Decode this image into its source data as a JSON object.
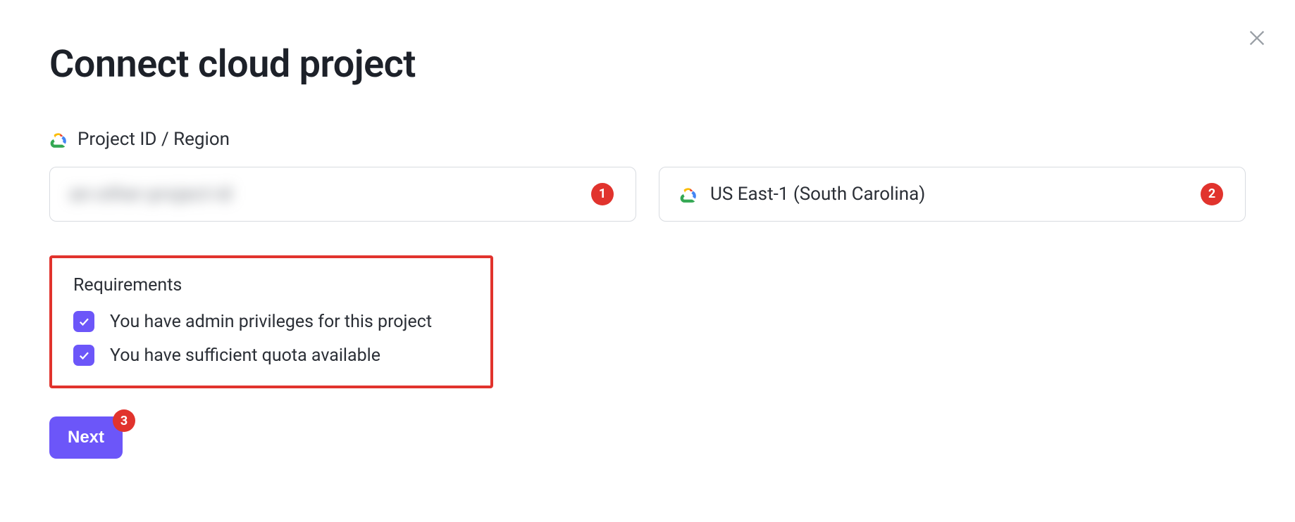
{
  "header": {
    "title": "Connect cloud project"
  },
  "section": {
    "label": "Project ID / Region"
  },
  "fields": {
    "project_id": {
      "value_obscured": "an-other-project-id",
      "badge": "1"
    },
    "region": {
      "value": "US East-1 (South Carolina)",
      "badge": "2"
    }
  },
  "requirements": {
    "title": "Requirements",
    "items": [
      {
        "label": "You have admin privileges for this project",
        "checked": true
      },
      {
        "label": "You have sufficient quota available",
        "checked": true
      }
    ]
  },
  "actions": {
    "next_label": "Next",
    "next_badge": "3"
  }
}
